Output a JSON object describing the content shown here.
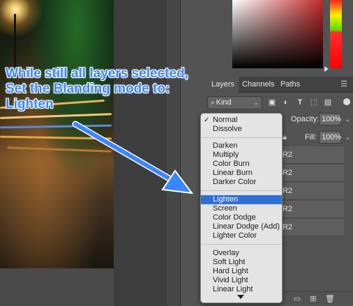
{
  "annotation": {
    "line1": "While still all layers selected,",
    "line2": "Set the Blanding mode to:",
    "line3": "Lighten",
    "color": "#3a86ff"
  },
  "panel": {
    "tabs": [
      "Layers",
      "Channels",
      "Paths"
    ],
    "menu_icon": "hamburger-menu-icon",
    "filter": {
      "kind_label": "Kind",
      "kind_icon": "search-icon",
      "icons": [
        "image-filter-icon",
        "adjustment-filter-icon",
        "type-filter-icon",
        "shape-filter-icon",
        "smart-object-filter-icon"
      ]
    },
    "opacity_label": "Opacity:",
    "opacity_value": "100%",
    "fill_label": "Fill:",
    "fill_value": "100%",
    "layers": [
      "CR2",
      "CR2",
      "CR2",
      "CR2",
      "CR2"
    ]
  },
  "blend_menu": {
    "groups": [
      [
        "Normal",
        "Dissolve"
      ],
      [
        "Darken",
        "Multiply",
        "Color Burn",
        "Linear Burn",
        "Darker Color"
      ],
      [
        "Lighten",
        "Screen",
        "Color Dodge",
        "Linear Dodge (Add)",
        "Lighter Color"
      ],
      [
        "Overlay",
        "Soft Light",
        "Hard Light",
        "Vivid Light",
        "Linear Light"
      ]
    ],
    "checked": "Normal",
    "highlighted": "Lighten",
    "highlight_color": "#2f6fd6"
  },
  "colors": {
    "panel_bg": "#535353",
    "accent_blue": "#3a86ff"
  }
}
